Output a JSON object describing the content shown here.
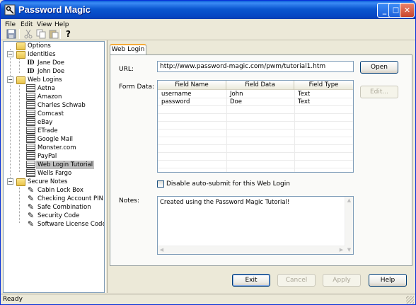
{
  "window": {
    "title": "Password Magic"
  },
  "menu": [
    {
      "label": "File",
      "underline": "F"
    },
    {
      "label": "Edit",
      "underline": "E"
    },
    {
      "label": "View",
      "underline": "V"
    },
    {
      "label": "Help",
      "underline": "H"
    }
  ],
  "toolbar": {
    "icons": [
      "save-icon",
      "cut-icon",
      "copy-icon",
      "paste-icon",
      "help-icon"
    ]
  },
  "tree": {
    "options": "Options",
    "identities": {
      "label": "Identities",
      "children": [
        "Jane Doe",
        "John Doe"
      ]
    },
    "web_logins": {
      "label": "Web Logins",
      "children": [
        "Aetna",
        "Amazon",
        "Charles Schwab",
        "Comcast",
        "eBay",
        "ETrade",
        "Google Mail",
        "Monster.com",
        "PayPal",
        "Web Login Tutorial",
        "Wells Fargo"
      ],
      "selected": "Web Login Tutorial"
    },
    "secure_notes": {
      "label": "Secure Notes",
      "children": [
        "Cabin Lock Box",
        "Checking Account PIN",
        "Safe Combination",
        "Security Code",
        "Software License Codes"
      ]
    },
    "id_glyph": "ID"
  },
  "tab": {
    "label": "Web Login"
  },
  "form": {
    "url_label": "URL:",
    "url_value": "http://www.password-magic.com/pwm/tutorial1.htm",
    "open_label": "Open",
    "form_data_label": "Form Data:",
    "edit_label": "Edit...",
    "columns": [
      "Field Name",
      "Field Data",
      "Field Type"
    ],
    "rows": [
      [
        "username",
        "John",
        "Text"
      ],
      [
        "password",
        "Doe",
        "Text"
      ]
    ],
    "disable_autosubmit_label": "Disable auto-submit for this Web Login",
    "disable_autosubmit_checked": false,
    "notes_label": "Notes:",
    "notes_value": "Created using the Password Magic Tutorial!"
  },
  "buttons": {
    "exit": "Exit",
    "cancel": "Cancel",
    "apply": "Apply",
    "help": "Help"
  },
  "status": {
    "text": "Ready"
  },
  "title_buttons": {
    "minimize": "_",
    "maximize": "□",
    "close": "✕"
  },
  "colors": {
    "titlebar": "#0b57d0",
    "selected_row": "#c0c0c0",
    "tab_accent": "#f6ab39"
  }
}
